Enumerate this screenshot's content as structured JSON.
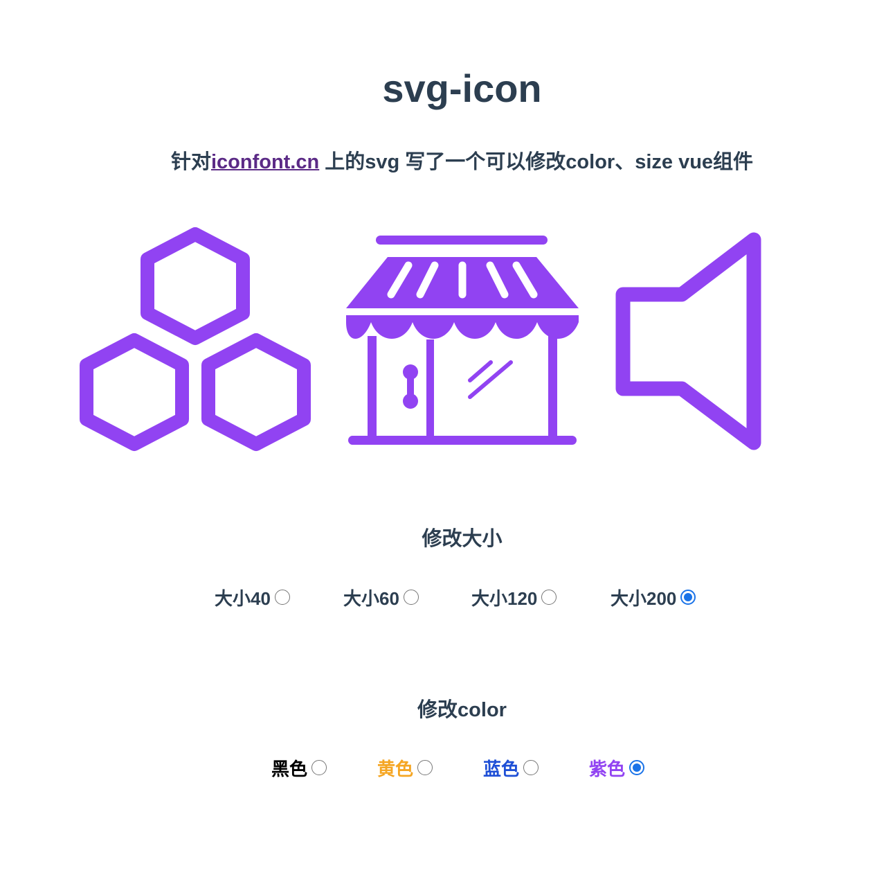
{
  "header": {
    "title": "svg-icon",
    "desc_prefix": "针对",
    "desc_link": "iconfont.cn",
    "desc_suffix": " 上的svg 写了一个可以修改color、size vue组件"
  },
  "icons": {
    "color": "#9143f2",
    "names": [
      "hexagons-icon",
      "store-icon",
      "speaker-icon"
    ]
  },
  "size_section": {
    "title": "修改大小",
    "options": [
      {
        "label": "大小40",
        "checked": false
      },
      {
        "label": "大小60",
        "checked": false
      },
      {
        "label": "大小120",
        "checked": false
      },
      {
        "label": "大小200",
        "checked": true
      }
    ]
  },
  "color_section": {
    "title": "修改color",
    "options": [
      {
        "label": "黑色",
        "color": "#000000",
        "checked": false
      },
      {
        "label": "黄色",
        "color": "#f5a623",
        "checked": false
      },
      {
        "label": "蓝色",
        "color": "#1e4fd6",
        "checked": false
      },
      {
        "label": "紫色",
        "color": "#9143f2",
        "checked": true
      }
    ]
  }
}
